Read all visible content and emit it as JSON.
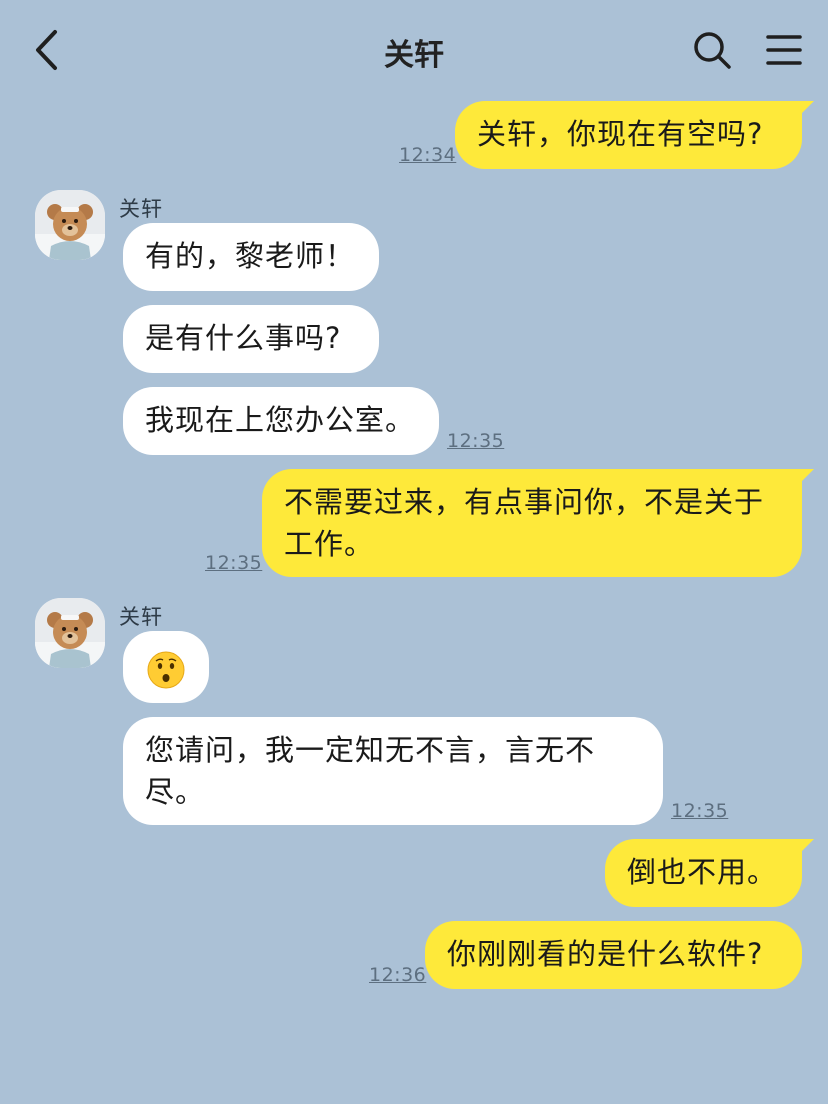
{
  "header": {
    "title": "关轩",
    "back_icon": "chevron-left-icon",
    "search_icon": "search-icon",
    "menu_icon": "hamburger-menu-icon"
  },
  "colors": {
    "background": "#abc1d6",
    "outgoing_bubble": "#fee93a",
    "incoming_bubble": "#ffffff"
  },
  "messages": [
    {
      "side": "me",
      "text": "关轩，你现在有空吗?",
      "time": "12:34"
    },
    {
      "side": "them",
      "sender": "关轩",
      "text": "有的，黎老师！"
    },
    {
      "side": "them",
      "text": "是有什么事吗?"
    },
    {
      "side": "them",
      "text": "我现在上您办公室。",
      "time": "12:35"
    },
    {
      "side": "me",
      "text": "不需要过来，有点事问你，不是关于工作。",
      "time": "12:35"
    },
    {
      "side": "them",
      "sender": "关轩",
      "emoji": "hushed-face-emoji"
    },
    {
      "side": "them",
      "text": "您请问，我一定知无不言，言无不尽。",
      "time": "12:35"
    },
    {
      "side": "me",
      "text": "倒也不用。"
    },
    {
      "side": "me",
      "text": "你刚刚看的是什么软件?",
      "time": "12:36"
    }
  ]
}
